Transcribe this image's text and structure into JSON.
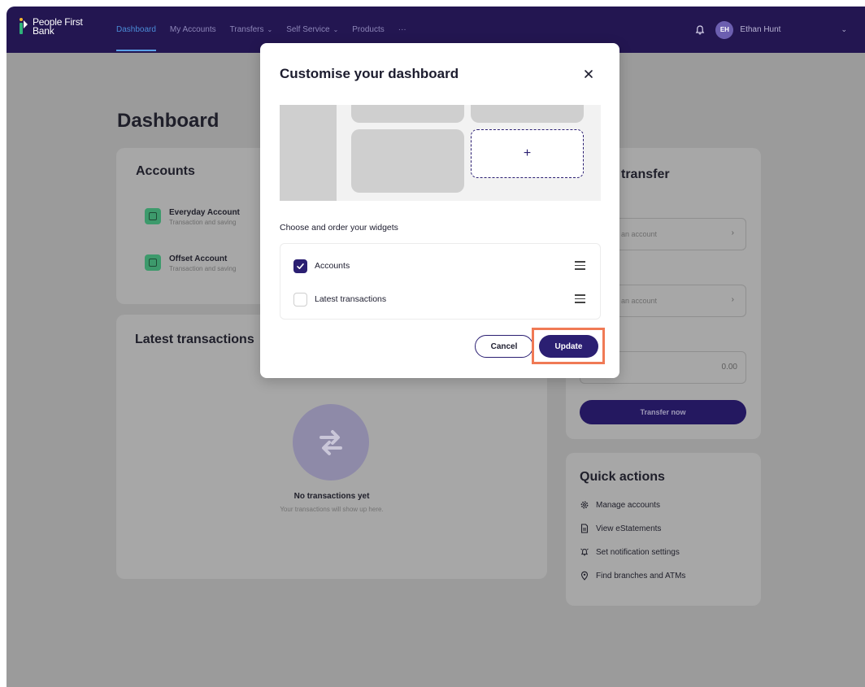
{
  "brand": {
    "line1": "People First",
    "line2": "Bank"
  },
  "nav": {
    "items": [
      {
        "label": "Dashboard",
        "caret": ""
      },
      {
        "label": "My Accounts",
        "caret": ""
      },
      {
        "label": "Transfers",
        "caret": "⌄"
      },
      {
        "label": "Self Service",
        "caret": "⌄"
      },
      {
        "label": "Products",
        "caret": ""
      },
      {
        "label": "···",
        "caret": ""
      }
    ],
    "user_initials": "EH",
    "user_name": "Ethan Hunt"
  },
  "page": {
    "title": "Dashboard"
  },
  "accounts_card": {
    "title": "Accounts",
    "items": [
      {
        "name": "Everyday Account",
        "sub": "Transaction and saving"
      },
      {
        "name": "Offset Account",
        "sub": "Transaction and saving"
      }
    ]
  },
  "transactions_card": {
    "title": "Latest transactions",
    "empty_title": "No transactions yet",
    "empty_sub": "Your transactions will show up here."
  },
  "transfer_card": {
    "title": "transfer",
    "from_text": "an account",
    "to_text": "an account",
    "amount": "0.00",
    "button": "Transfer now"
  },
  "quick_actions": {
    "title": "Quick actions",
    "items": [
      {
        "label": "Manage accounts",
        "icon": "gear-icon"
      },
      {
        "label": "View eStatements",
        "icon": "document-icon"
      },
      {
        "label": "Set notification settings",
        "icon": "alarm-icon"
      },
      {
        "label": "Find branches and ATMs",
        "icon": "location-pin-icon"
      }
    ]
  },
  "modal": {
    "title": "Customise your dashboard",
    "add_glyph": "+",
    "choose_label": "Choose and order your widgets",
    "widgets": [
      {
        "label": "Accounts",
        "checked": true
      },
      {
        "label": "Latest transactions",
        "checked": false
      }
    ],
    "cancel_label": "Cancel",
    "update_label": "Update"
  },
  "colors": {
    "nav_bg": "#231651",
    "primary": "#2b1f72",
    "highlight": "#f07a55",
    "overlay": "#9b9b9b"
  }
}
